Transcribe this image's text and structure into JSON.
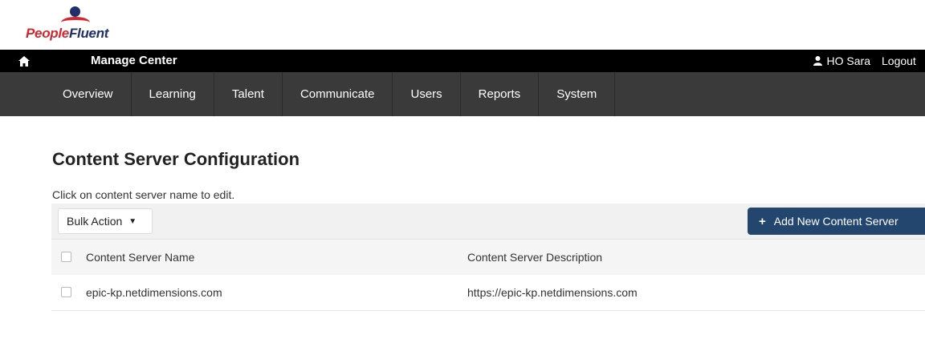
{
  "brand": {
    "logo_people": "People",
    "logo_fluent": "Fluent"
  },
  "topbar": {
    "title": "Manage Center",
    "user_name": "HO Sara",
    "logout": "Logout"
  },
  "nav": {
    "items": [
      "Overview",
      "Learning",
      "Talent",
      "Communicate",
      "Users",
      "Reports",
      "System"
    ]
  },
  "page": {
    "title": "Content Server Configuration",
    "hint": "Click on content server name to edit."
  },
  "toolbar": {
    "bulk_action": "Bulk Action",
    "add_button": "Add New Content Server"
  },
  "table": {
    "headers": [
      "Content Server Name",
      "Content Server Description"
    ],
    "rows": [
      {
        "name": "epic-kp.netdimensions.com",
        "description": "https://epic-kp.netdimensions.com"
      }
    ]
  }
}
